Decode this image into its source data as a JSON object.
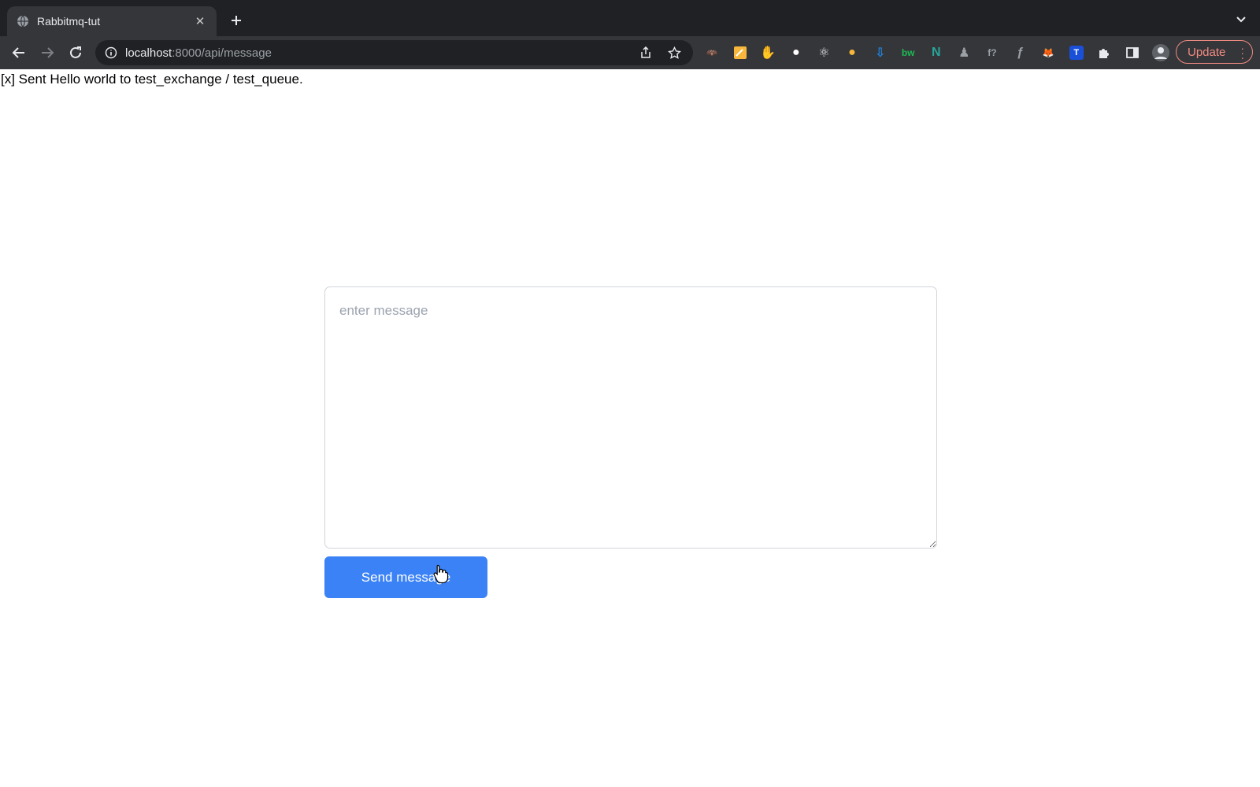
{
  "browser": {
    "tab": {
      "title": "Rabbitmq-tut",
      "close_glyph": "✕"
    },
    "address": {
      "host": "localhost",
      "path": ":8000/api/message"
    },
    "update_label": "Update",
    "extensions": [
      {
        "name": "extension-bat-icon",
        "glyph": "🦇",
        "color": "#9aa0a6"
      },
      {
        "name": "extension-notes-icon",
        "glyph": "",
        "color": "#f6b73c"
      },
      {
        "name": "extension-stop-hand-icon",
        "glyph": "✋",
        "color": "#e53935"
      },
      {
        "name": "extension-circle-icon",
        "glyph": "●",
        "color": "#ffffff"
      },
      {
        "name": "extension-react-icon",
        "glyph": "⚛",
        "color": "#e8eaed"
      },
      {
        "name": "extension-sun-icon",
        "glyph": "●",
        "color": "#f6b73c"
      },
      {
        "name": "extension-download-icon",
        "glyph": "⇩",
        "color": "#1e88e5"
      },
      {
        "name": "extension-bw-icon",
        "glyph": "bw",
        "color": "#1db954"
      },
      {
        "name": "extension-n-icon",
        "glyph": "N",
        "color": "#26a69a"
      },
      {
        "name": "extension-chess-icon",
        "glyph": "♟",
        "color": "#9aa0a6"
      },
      {
        "name": "extension-formula-icon",
        "glyph": "f?",
        "color": "#9aa0a6"
      },
      {
        "name": "extension-feather-icon",
        "glyph": "ƒ",
        "color": "#9aa0a6"
      },
      {
        "name": "extension-fox-icon",
        "glyph": "🦊",
        "color": "#f57c00"
      },
      {
        "name": "extension-t-icon",
        "glyph": "T",
        "color": "#ffffff"
      },
      {
        "name": "extensions-puzzle-icon",
        "glyph": "",
        "color": "#e8eaed"
      },
      {
        "name": "side-panel-icon",
        "glyph": "",
        "color": "#e8eaed"
      },
      {
        "name": "profile-avatar-icon",
        "glyph": "",
        "color": "#e8eaed"
      }
    ]
  },
  "page": {
    "status_text": "[x] Sent Hello world to test_exchange / test_queue.",
    "message_placeholder": "enter message",
    "message_value": "",
    "send_label": "Send message"
  },
  "colors": {
    "accent": "#3b82f6",
    "chrome_dark": "#202124",
    "toolbar": "#35363a",
    "update": "#f28b82"
  }
}
